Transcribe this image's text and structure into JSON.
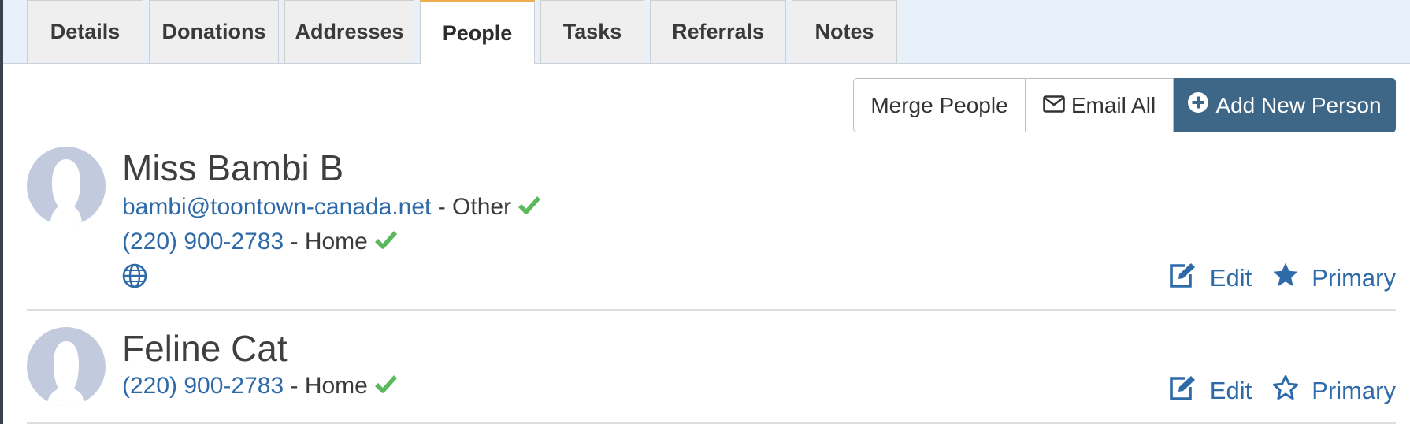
{
  "tabs": [
    {
      "label": "Details"
    },
    {
      "label": "Donations"
    },
    {
      "label": "Addresses"
    },
    {
      "label": "People"
    },
    {
      "label": "Tasks"
    },
    {
      "label": "Referrals"
    },
    {
      "label": "Notes"
    }
  ],
  "active_tab": "People",
  "toolbar": {
    "merge_label": "Merge People",
    "email_all_label": "Email All",
    "add_person_label": "Add New Person"
  },
  "people": [
    {
      "name": "Miss Bambi B",
      "email": "bambi@toontown-canada.net",
      "email_type": "- Other",
      "phone": "(220) 900-2783",
      "phone_type": "- Home",
      "edit_label": "Edit",
      "primary_label": "Primary",
      "is_primary": true
    },
    {
      "name": "Feline Cat",
      "phone": "(220) 900-2783",
      "phone_type": "- Home",
      "edit_label": "Edit",
      "primary_label": "Primary",
      "is_primary": false
    }
  ],
  "colors": {
    "accent": "#3e6787",
    "link": "#2f6aa8",
    "check": "#5cb85c",
    "active_tab_border": "#f0ad4e",
    "tabbar_bg": "#e8f0f9"
  }
}
